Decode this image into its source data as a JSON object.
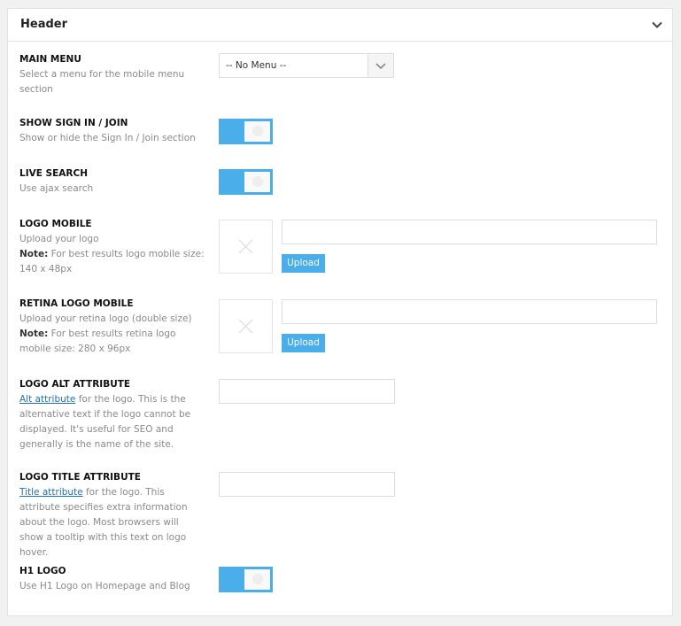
{
  "panel": {
    "title": "Header"
  },
  "main_menu": {
    "title": "MAIN MENU",
    "desc": "Select a menu for the mobile menu section",
    "value": "-- No Menu --"
  },
  "sign_in": {
    "title": "SHOW SIGN IN / JOIN",
    "desc": "Show or hide the Sign In / Join section",
    "enabled": true
  },
  "live_search": {
    "title": "LIVE SEARCH",
    "desc": "Use ajax search",
    "enabled": true
  },
  "logo_mobile": {
    "title": "LOGO MOBILE",
    "desc": "Upload your logo",
    "note_label": "Note:",
    "note": " For best results logo mobile size: 140 x 48px",
    "upload_label": "Upload"
  },
  "retina_logo": {
    "title": "RETINA LOGO MOBILE",
    "desc": "Upload your retina logo (double size)",
    "note_label": "Note:",
    "note": " For best results retina logo mobile size: 280 x 96px",
    "upload_label": "Upload"
  },
  "logo_alt": {
    "title": "LOGO ALT ATTRIBUTE",
    "link": "Alt attribute",
    "desc": " for the logo. This is the alternative text if the logo cannot be displayed. It's useful for SEO and generally is the name of the site."
  },
  "logo_title": {
    "title": "LOGO TITLE ATTRIBUTE",
    "link": "Title attribute",
    "desc": " for the logo. This attribute specifies extra information about the logo. Most browsers will show a tooltip with this text on logo hover."
  },
  "h1_logo": {
    "title": "H1 LOGO",
    "desc": "Use H1 Logo on Homepage and Blog",
    "enabled": true
  },
  "colors": {
    "accent": "#4aaeea",
    "link": "#2271b1"
  }
}
